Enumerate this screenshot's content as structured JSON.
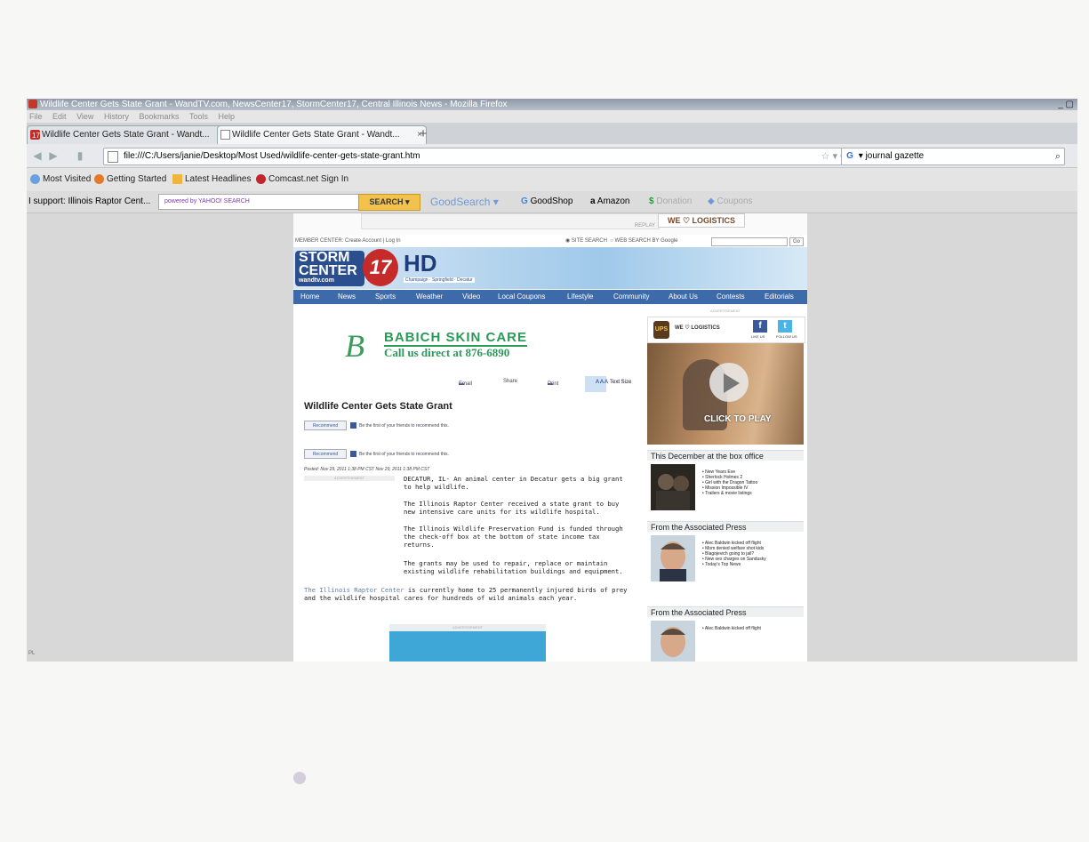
{
  "window": {
    "title": "Wildlife Center Gets State Grant - WandTV.com, NewsCenter17, StormCenter17, Central Illinois News - Mozilla Firefox",
    "controls": "_ ▢"
  },
  "menu": [
    "File",
    "Edit",
    "View",
    "History",
    "Bookmarks",
    "Tools",
    "Help"
  ],
  "tabs": [
    {
      "label": "Wildlife Center Gets State Grant - Wandt...",
      "close": "×"
    },
    {
      "label": "Wildlife Center Gets State Grant - Wandt...",
      "close": "×"
    }
  ],
  "newtab": "+",
  "address": {
    "url": "file:///C:/Users/janie/Desktop/Most Used/wildlife-center-gets-state-grant.htm",
    "right_icons": "☆ ▾ C"
  },
  "searchbar": {
    "value": "journal gazette",
    "engine_icon": "G"
  },
  "bookmarks": [
    "Most Visited",
    "Getting Started",
    "Latest Headlines",
    "Comcast.net Sign In"
  ],
  "toolbar": {
    "support": "I support: Illinois Raptor Cent...",
    "search_placeholder": "powered by YAHOO! SEARCH",
    "search_button": "SEARCH ▾",
    "goodsearch": "GoodSearch ▾",
    "goodshop": "GoodShop",
    "amazon": "Amazon",
    "donation": "Donation",
    "coupons": "Coupons"
  },
  "site": {
    "topad_label": "REPLAY",
    "top_logistics": "WE ♡ LOGISTICS",
    "member_center": "MEMBER CENTER: Create Account | Log In",
    "site_search": "SITE SEARCH",
    "web_search": "WEB SEARCH BY Google",
    "go": "Go",
    "logo_storm": "STORM",
    "logo_center": "CENTER",
    "logo_domain": "wandtv.com",
    "logo_17": "17",
    "logo_hd": "HD",
    "logo_cities": "Champaign · Springfield · Decatur",
    "nav": [
      "Home",
      "News",
      "Sports",
      "Weather",
      "Video",
      "Local Coupons",
      "Lifestyle",
      "Community",
      "About Us",
      "Contests",
      "Editorials"
    ]
  },
  "ad": {
    "monogram": "B",
    "line1": "BABICH SKIN CARE",
    "line2": "Call us direct at 876-6890"
  },
  "article_tools": {
    "email": "Email",
    "share": "Share",
    "print": "Print",
    "size_letters": "A A A",
    "text_size": "Text Size"
  },
  "article": {
    "headline": "Wildlife Center Gets State Grant",
    "recommend": "Recommend",
    "recommend_text": "Be the first of your friends to recommend this.",
    "posted": "Posted: Nov 29, 2011 1:38 PM CST  Nov 29, 2011 1:38 PM CST",
    "advertisement": "ADVERTISEMENT",
    "paragraphs": [
      "DECATUR, IL- An animal center in Decatur gets a big grant to help wildlife.",
      "The Illinois Raptor Center received a state grant to buy new intensive care units for its wildlife hospital.",
      "The Illinois Wildlife Preservation Fund is funded through the check-off box at the bottom of state income tax returns.",
      "The grants may be used to repair, replace or maintain existing wildlife rehabilitation buildings and equipment."
    ],
    "last_link": "The Illinois Raptor Center",
    "last_rest": " is currently home to 25 permanently injured birds of prey and the wildlife hospital cares for hundreds of wild animals each year."
  },
  "sidebar": {
    "advertisement": "ADVERTISEMENT",
    "ups": "UPS",
    "we_logistics": "WE ♡ LOGISTICS",
    "like_us": "LIKE US",
    "follow_us": "FOLLOW US",
    "click_to_play": "CLICK TO PLAY",
    "box_office_title": "This December at the box office",
    "box_office_items": [
      "New Years Eve",
      "Sherlock Holmes 2",
      "Girl with the Dragon Tattoo",
      "Mission Impossible IV",
      "Trailers & movie listings"
    ],
    "ap_title": "From the Associated Press",
    "ap_items": [
      "Alec Baldwin kicked off flight",
      "Mom denied welfare shot kids",
      "Blagojevich going to jail?",
      "New sex charges on Sandusky",
      "Today's Top News"
    ],
    "ap_title2": "From the Associated Press",
    "ap_items2": [
      "Alec Baldwin kicked off flight"
    ]
  },
  "status_bar": "PL",
  "colors": {
    "nav_blue": "#3d6aa8",
    "ad_green": "#2a9a58",
    "storm_red": "#c62b2b"
  }
}
